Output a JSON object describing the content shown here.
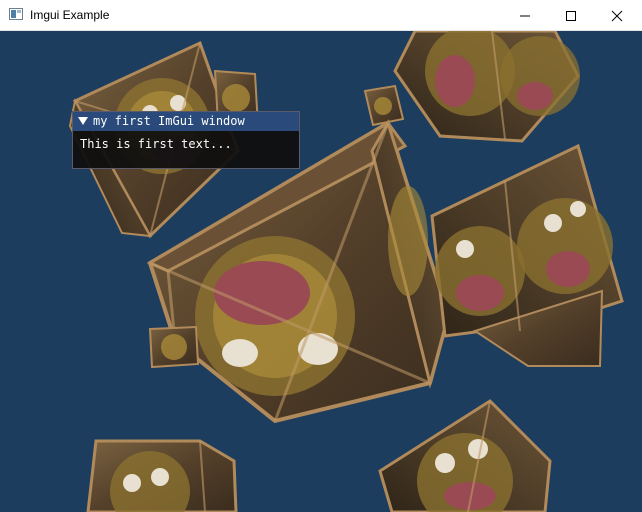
{
  "window": {
    "title": "Imgui Example",
    "icon": "app-window-icon",
    "controls": [
      "minimize-icon",
      "maximize-icon",
      "close-icon"
    ]
  },
  "viewport": {
    "background_color": "#1d3d5e",
    "content": "rotating textured crates"
  },
  "imgui_window": {
    "title": "my first ImGui window",
    "text": "This is first text...",
    "title_bg_color": "#294a7a",
    "collapse_icon": "collapse-arrow-icon"
  }
}
